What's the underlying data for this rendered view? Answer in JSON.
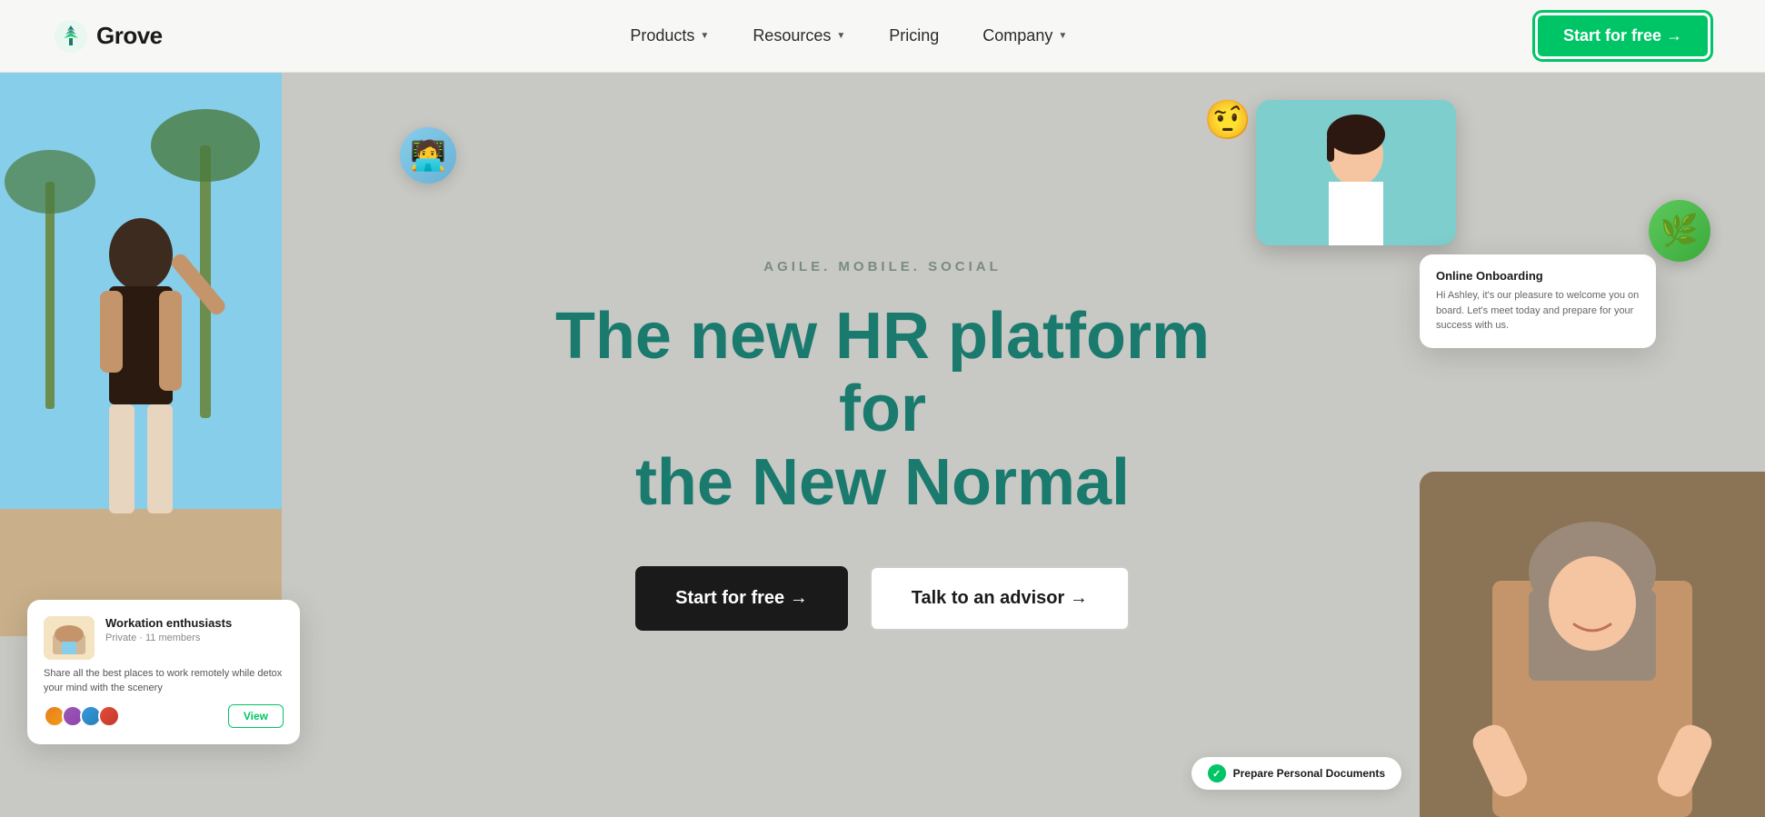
{
  "logo": {
    "text": "Grove",
    "icon_alt": "grove-logo"
  },
  "nav": {
    "links": [
      {
        "label": "Products",
        "has_dropdown": true
      },
      {
        "label": "Resources",
        "has_dropdown": true
      },
      {
        "label": "Pricing",
        "has_dropdown": false
      },
      {
        "label": "Company",
        "has_dropdown": true
      }
    ],
    "cta_label": "Start for free →"
  },
  "hero": {
    "subtitle": "AGILE. MOBILE. SOCIAL",
    "title_line1": "The new HR platform for",
    "title_line2": "the New Normal",
    "btn_primary": "Start for free →",
    "btn_secondary": "Talk to an advisor →"
  },
  "workation_card": {
    "title": "Workation enthusiasts",
    "meta": "Private · 11 members",
    "description": "Share all the best places to work remotely while detox your mind with the scenery",
    "btn_label": "View"
  },
  "onboarding_card": {
    "title": "Online Onboarding",
    "body": "Hi Ashley, it's our pleasure to welcome you on board. Let's meet today and prepare for your success with us."
  },
  "prepare_badge": {
    "label": "Prepare Personal Documents"
  },
  "colors": {
    "brand_green": "#00c566",
    "hero_teal": "#1a7a6e",
    "nav_bg": "rgba(255,255,255,0.85)"
  }
}
